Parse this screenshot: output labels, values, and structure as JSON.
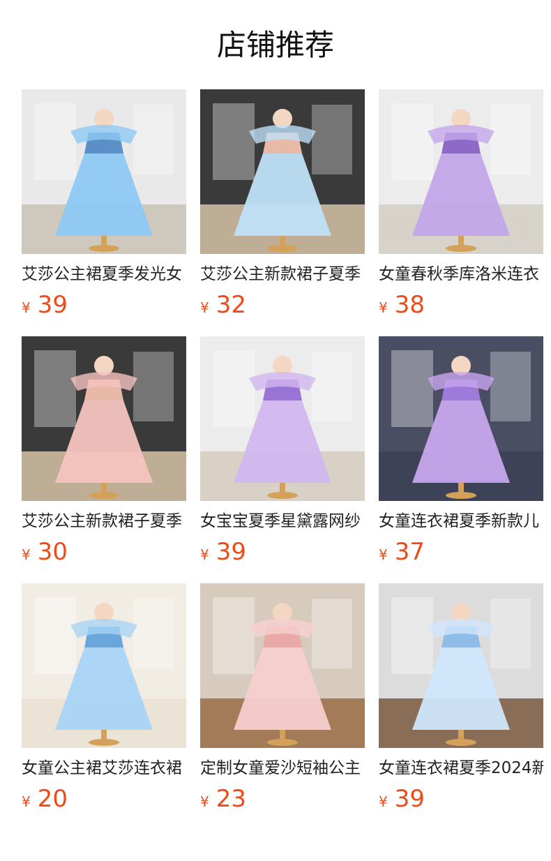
{
  "header": {
    "title": "店铺推荐"
  },
  "products": [
    {
      "title": "艾莎公主裙夏季发光女",
      "currency": "¥",
      "price": "39",
      "image_icon": "blue-princess-dress-photo",
      "colors": {
        "bg": "#e9e9e9",
        "floor": "#cfc8bd",
        "dress": "#8ec9f4",
        "accent": "#5b8fc8"
      }
    },
    {
      "title": "艾莎公主新款裙子夏季",
      "currency": "¥",
      "price": "32",
      "image_icon": "girl-blue-dress-photo",
      "colors": {
        "bg": "#3a3a3a",
        "floor": "#bfae96",
        "dress": "#bfe0f7",
        "accent": "#e7b9a6"
      }
    },
    {
      "title": "女童春秋季库洛米连衣",
      "currency": "¥",
      "price": "38",
      "image_icon": "purple-kuromi-dress-photo",
      "colors": {
        "bg": "#ececec",
        "floor": "#d7d2ca",
        "dress": "#c3a7ea",
        "accent": "#8e69c8"
      }
    },
    {
      "title": "艾莎公主新款裙子夏季",
      "currency": "¥",
      "price": "30",
      "image_icon": "girl-pink-dress-photo",
      "colors": {
        "bg": "#3a3a3a",
        "floor": "#bfae96",
        "dress": "#f6c3bf",
        "accent": "#e7b9a6"
      }
    },
    {
      "title": "女宝宝夏季星黛露网纱",
      "currency": "¥",
      "price": "39",
      "image_icon": "purple-stellalou-dress-photo",
      "colors": {
        "bg": "#ececec",
        "floor": "#d9d1c6",
        "dress": "#d2b7ef",
        "accent": "#9a73d6"
      }
    },
    {
      "title": "女童连衣裙夏季新款儿",
      "currency": "¥",
      "price": "37",
      "image_icon": "purple-kuromi-bow-dress-photo",
      "colors": {
        "bg": "#4a4e63",
        "floor": "#3d4257",
        "dress": "#c7a6ee",
        "accent": "#9e7ad9"
      }
    },
    {
      "title": "女童公主裙艾莎连衣裙",
      "currency": "¥",
      "price": "20",
      "image_icon": "elsa-tutu-dress-photo",
      "colors": {
        "bg": "#f1ece4",
        "floor": "#ece3d7",
        "dress": "#a9d4f5",
        "accent": "#6aa5dc"
      }
    },
    {
      "title": "定制女童爱沙短袖公主",
      "currency": "¥",
      "price": "23",
      "image_icon": "girl-pink-tulle-dress-photo",
      "colors": {
        "bg": "#d7cbbd",
        "floor": "#a37b58",
        "dress": "#f6cfcf",
        "accent": "#e9a9a6"
      }
    },
    {
      "title": "女童连衣裙夏季2024新",
      "currency": "¥",
      "price": "39",
      "image_icon": "girl-light-blue-dress-photo",
      "colors": {
        "bg": "#dcdcdc",
        "floor": "#8a6d56",
        "dress": "#cfe6fb",
        "accent": "#8fbde8"
      }
    }
  ]
}
